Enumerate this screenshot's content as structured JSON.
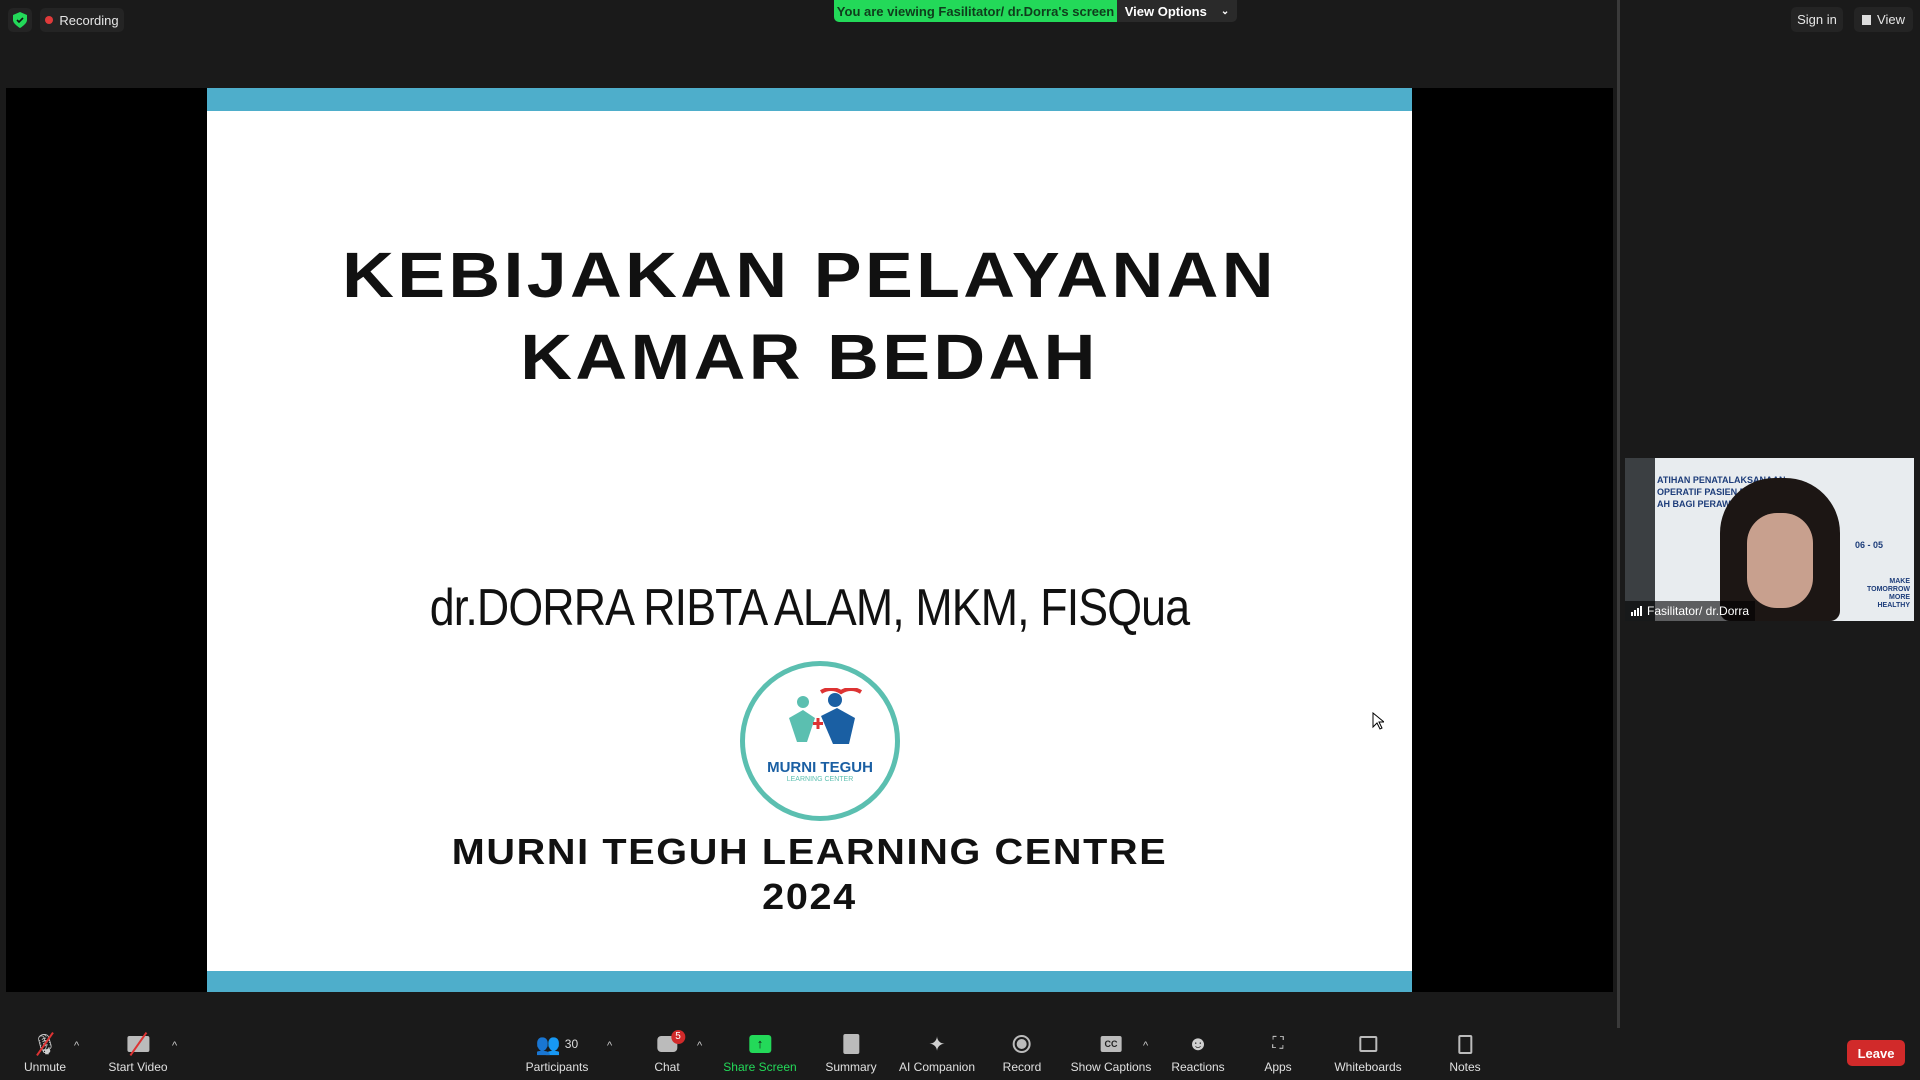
{
  "top": {
    "recording": "Recording",
    "banner": "You are viewing Fasilitator/ dr.Dorra's screen",
    "view_options": "View Options",
    "sign_in": "Sign in",
    "view": "View"
  },
  "slide": {
    "title_1": "KEBIJAKAN PELAYANAN",
    "title_2": "KAMAR BEDAH",
    "presenter": "dr.DORRA RIBTA ALAM, MKM, FISQua",
    "logo_text": "MURNI TEGUH",
    "logo_sub": "LEARNING CENTER",
    "org": "MURNI TEGUH LEARNING CENTRE",
    "year": "2024"
  },
  "video": {
    "name": "Fasilitator/ dr.Dorra",
    "bg_lines": [
      "ATIHAN PENATALAKSANAAN",
      "OPERATIF PASIEN DI KA",
      "AH BAGI PERAWAT"
    ],
    "dates": "06 - 05",
    "slogan": [
      "MAKE",
      "TOMORROW",
      "MORE",
      "HEALTHY"
    ]
  },
  "toolbar": {
    "unmute": "Unmute",
    "start_video": "Start Video",
    "participants": "Participants",
    "participants_count": "30",
    "chat": "Chat",
    "chat_badge": "5",
    "share_screen": "Share Screen",
    "summary": "Summary",
    "ai_companion": "AI Companion",
    "record": "Record",
    "show_captions": "Show Captions",
    "cc": "CC",
    "reactions": "Reactions",
    "apps": "Apps",
    "whiteboards": "Whiteboards",
    "notes": "Notes",
    "leave": "Leave"
  },
  "colors": {
    "accent_green": "#23d959",
    "slide_bar": "#4eaecb",
    "leave": "#d12a2a",
    "logo_teal": "#5bbfb0",
    "logo_blue": "#1a5fa3"
  }
}
